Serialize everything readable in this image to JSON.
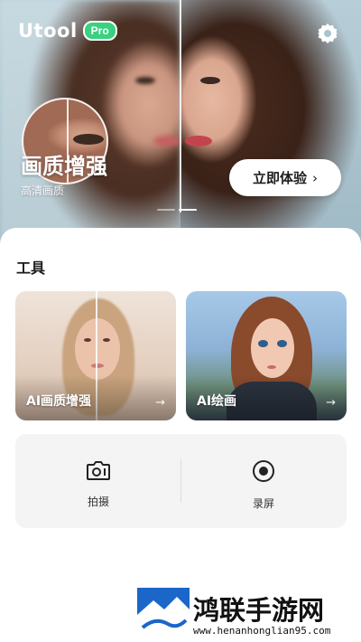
{
  "header": {
    "app_name": "Utool",
    "pro_badge": "Pro",
    "settings_icon": "gear-icon"
  },
  "banner": {
    "title": "画质增强",
    "subtitle": "高清画质",
    "cta_label": "立即体验",
    "cta_icon": "chevron-right-icon",
    "pager": {
      "count": 2,
      "active": 1
    }
  },
  "tools": {
    "section_title": "工具",
    "cards": [
      {
        "label": "AI画质增强",
        "arrow": "→"
      },
      {
        "label": "AI绘画",
        "arrow": "→"
      }
    ],
    "quick": [
      {
        "label": "拍摄",
        "icon": "camera-icon"
      },
      {
        "label": "录屏",
        "icon": "record-icon"
      }
    ]
  },
  "watermark": {
    "title": "鸿联手游网",
    "url": "www.henanhonglian95.com"
  },
  "colors": {
    "accent_green": "#3ad180",
    "text_dark": "#1b1b1b",
    "panel_bg": "#f4f4f4"
  }
}
